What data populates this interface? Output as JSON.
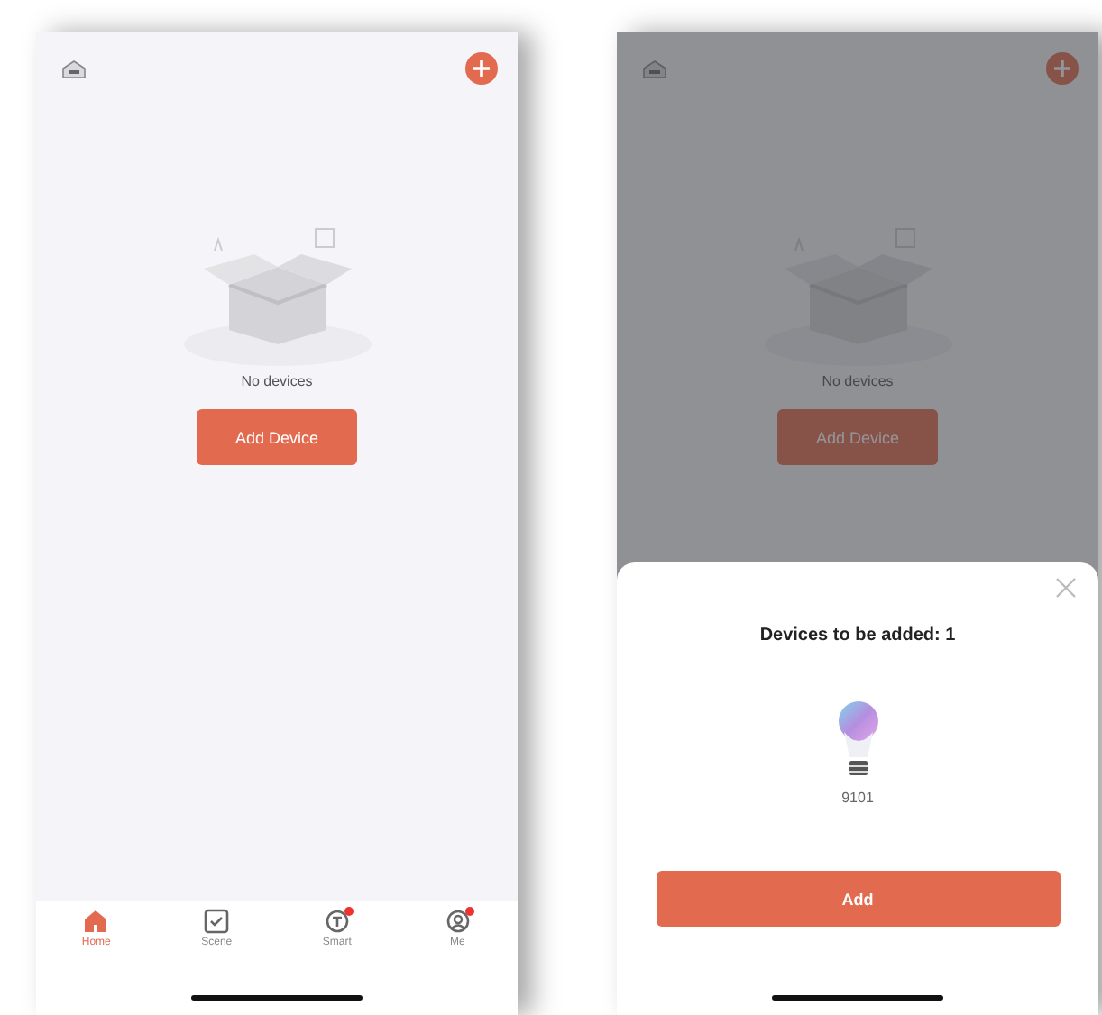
{
  "screens": [
    {
      "kind": "home",
      "empty_state": {
        "text": "No devices",
        "button": "Add Device"
      },
      "tabs": [
        {
          "label": "Home",
          "selected": true,
          "dot": false
        },
        {
          "label": "Scene",
          "selected": false,
          "dot": false
        },
        {
          "label": "Smart",
          "selected": false,
          "dot": true
        },
        {
          "label": "Me",
          "selected": false,
          "dot": true
        }
      ]
    },
    {
      "kind": "sheet",
      "empty_state": {
        "text": "No devices",
        "button": "Add Device"
      },
      "sheet": {
        "title": "Devices to be added: 1",
        "devices": [
          {
            "name": "9101"
          }
        ],
        "button": "Add"
      }
    }
  ]
}
